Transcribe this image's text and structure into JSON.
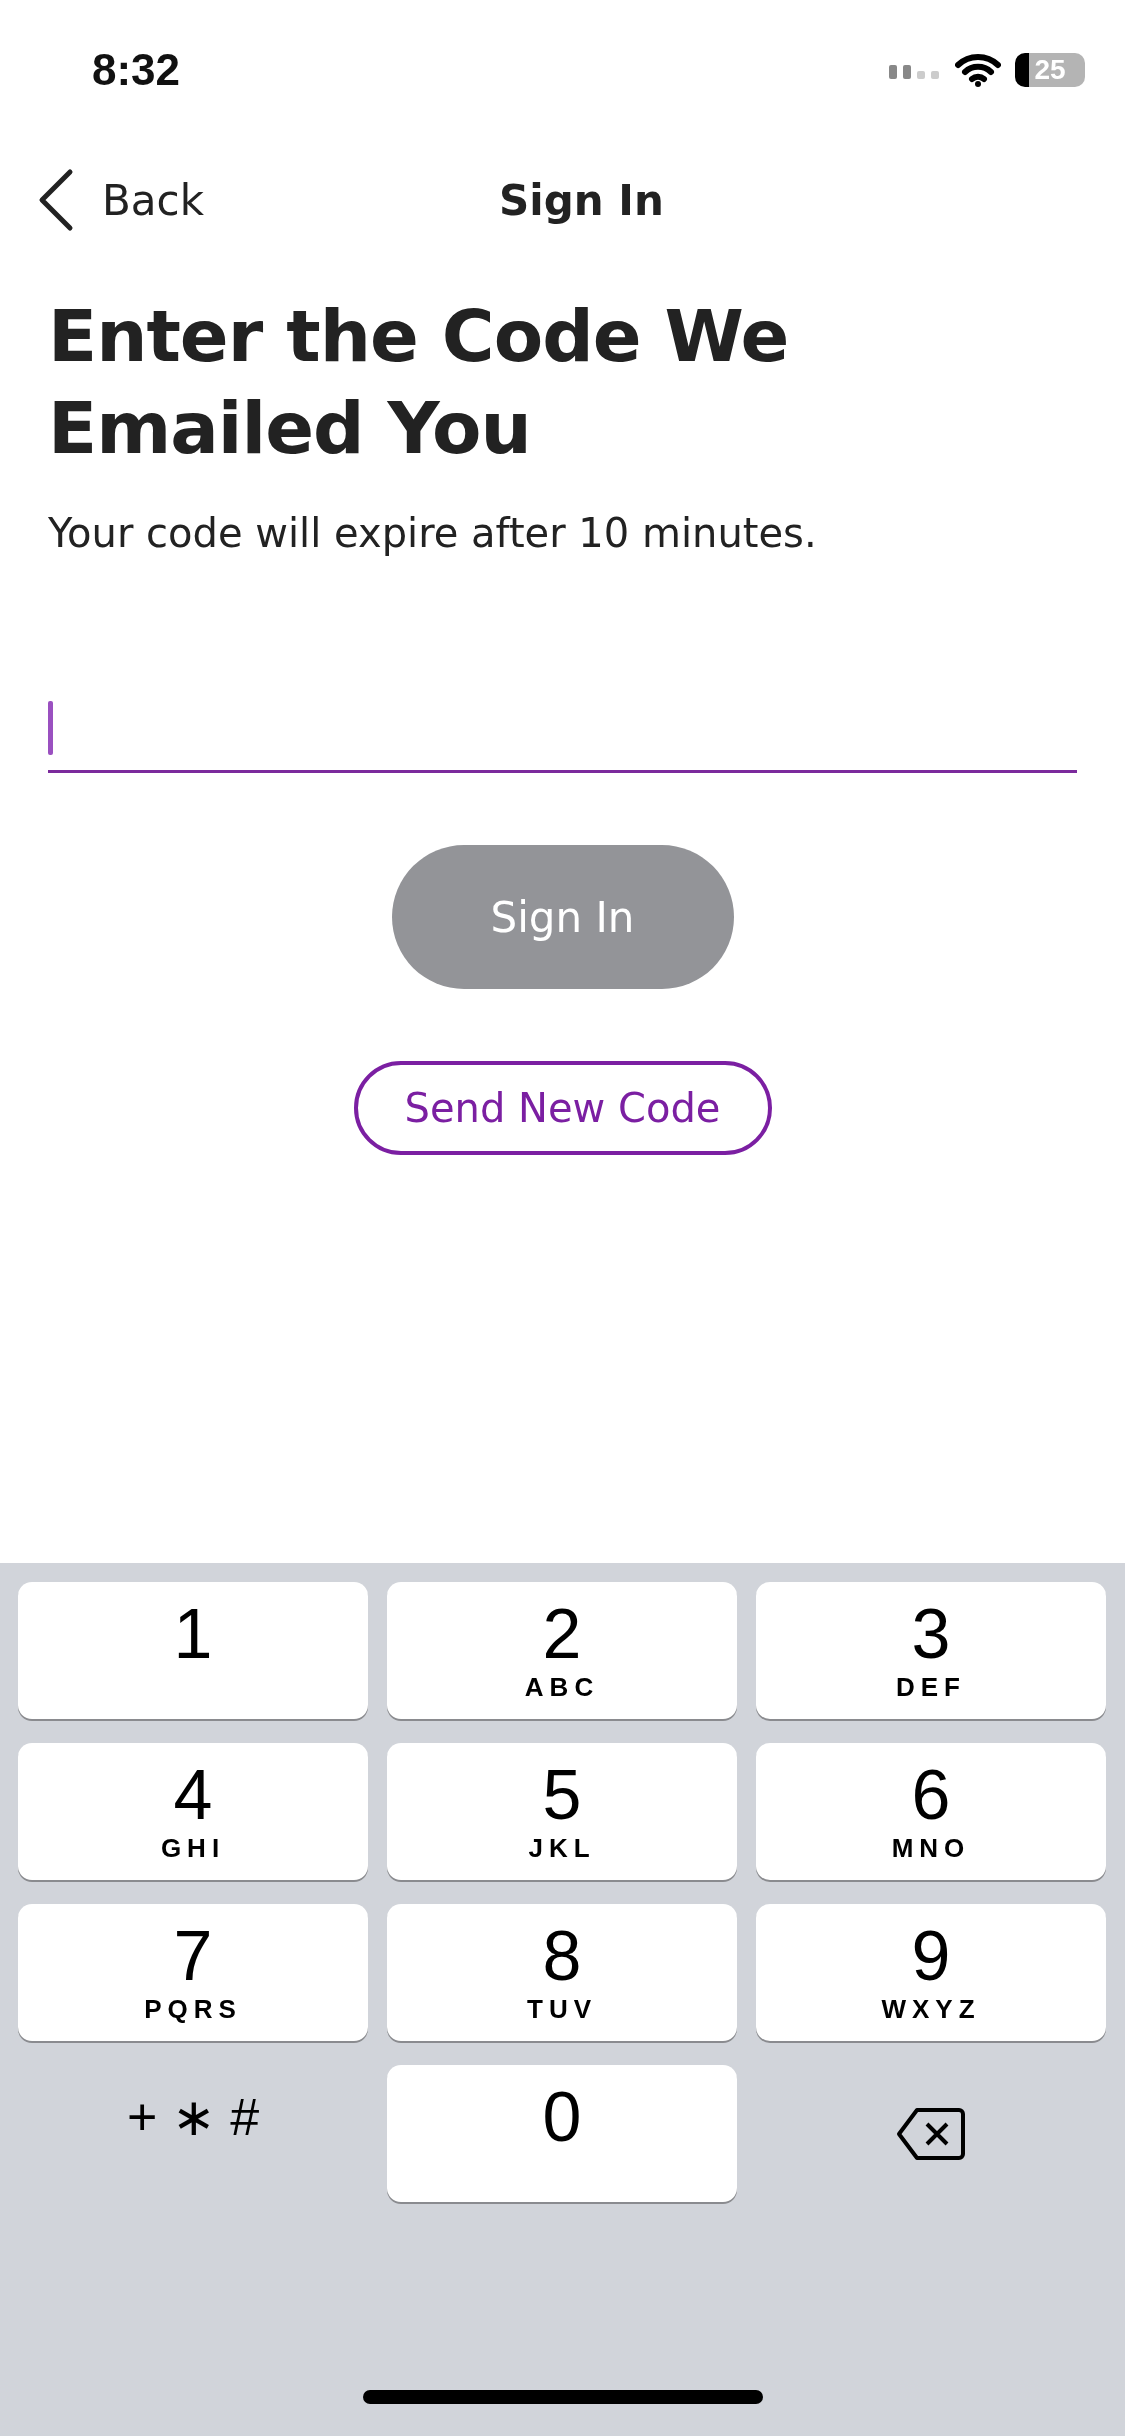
{
  "status_bar": {
    "time": "8:32",
    "battery": "25"
  },
  "nav": {
    "back": "Back",
    "title": "Sign In"
  },
  "heading": "Enter the Code We Emailed You",
  "subtitle": "Your code will expire after 10 minutes.",
  "code_field": {
    "focused": true
  },
  "sign_in_button": {
    "label": "Sign In",
    "disabled": true
  },
  "send_code_button": {
    "label": "Send New Code"
  },
  "keyboard": {
    "keys": [
      {
        "kind": "digit",
        "digit": "1"
      },
      {
        "kind": "digit",
        "digit": "2",
        "letters": "ABC"
      },
      {
        "kind": "digit",
        "digit": "3",
        "letters": "DEF"
      },
      {
        "kind": "digit",
        "digit": "4",
        "letters": "GHI"
      },
      {
        "kind": "digit",
        "digit": "5",
        "letters": "JKL"
      },
      {
        "kind": "digit",
        "digit": "6",
        "letters": "MNO"
      },
      {
        "kind": "digit",
        "digit": "7",
        "letters": "PQRS"
      },
      {
        "kind": "digit",
        "digit": "8",
        "letters": "TUV"
      },
      {
        "kind": "digit",
        "digit": "9",
        "letters": "WXYZ"
      },
      {
        "kind": "symbols",
        "digit": "+ ∗ #"
      },
      {
        "kind": "digit",
        "digit": "0"
      },
      {
        "kind": "delete"
      }
    ]
  }
}
